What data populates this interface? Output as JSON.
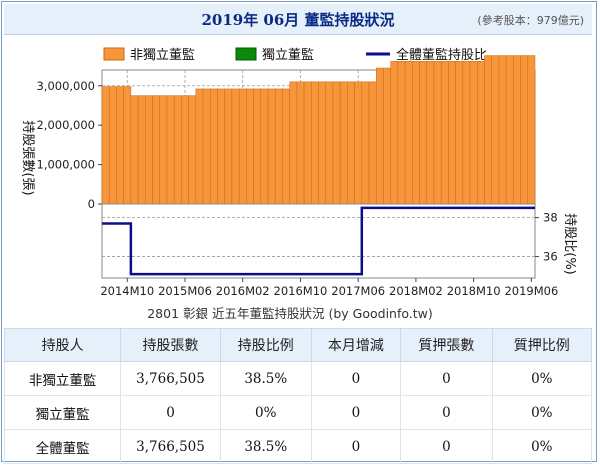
{
  "header": {
    "title": "2019年 06月 董監持股狀況",
    "note": "(參考股本：979億元)"
  },
  "colors": {
    "bar_fill": "#f7953a",
    "bar_stroke": "#c96a1c",
    "independent_fill": "#0a8a0a",
    "line": "#0d0d8a",
    "header_bg": "#e6f0fa"
  },
  "chart_data": {
    "type": "bar",
    "source_label": "2801 彰銀 近五年董監持股狀況 (by Goodinfo.tw)",
    "legend": [
      "非獨立董監",
      "獨立董監",
      "全體董監持股比"
    ],
    "ylabel_left": "持股張數(張)",
    "ylabel_right": "持股比(%)",
    "left_axis": {
      "ticks": [
        "3,000,000",
        "2,000,000",
        "1,000,000",
        "0"
      ],
      "tick_values": [
        3000000,
        2000000,
        1000000,
        0
      ],
      "ylim": [
        0,
        3400000
      ]
    },
    "right_axis": {
      "ticks": [
        "38",
        "36"
      ],
      "tick_values": [
        38,
        36
      ],
      "ylim": [
        34.9,
        38.7
      ]
    },
    "x_tick_labels": [
      "2014M10",
      "2015M06",
      "2016M02",
      "2016M10",
      "2017M06",
      "2018M02",
      "2018M10",
      "2019M06"
    ],
    "months": [
      "2014M07",
      "2014M08",
      "2014M09",
      "2014M10",
      "2014M11",
      "2014M12",
      "2015M01",
      "2015M02",
      "2015M03",
      "2015M04",
      "2015M05",
      "2015M06",
      "2015M07",
      "2015M08",
      "2015M09",
      "2015M10",
      "2015M11",
      "2015M12",
      "2016M01",
      "2016M02",
      "2016M03",
      "2016M04",
      "2016M05",
      "2016M06",
      "2016M07",
      "2016M08",
      "2016M09",
      "2016M10",
      "2016M11",
      "2016M12",
      "2017M01",
      "2017M02",
      "2017M03",
      "2017M04",
      "2017M05",
      "2017M06",
      "2017M07",
      "2017M08",
      "2017M09",
      "2017M10",
      "2017M11",
      "2017M12",
      "2018M01",
      "2018M02",
      "2018M03",
      "2018M04",
      "2018M05",
      "2018M06",
      "2018M07",
      "2018M08",
      "2018M09",
      "2018M10",
      "2018M11",
      "2018M12",
      "2019M01",
      "2019M02",
      "2019M03",
      "2019M04",
      "2019M05",
      "2019M06"
    ],
    "series": [
      {
        "name": "非獨立董監",
        "values": [
          2980000,
          2980000,
          2980000,
          2980000,
          2750000,
          2750000,
          2750000,
          2750000,
          2750000,
          2750000,
          2750000,
          2750000,
          2750000,
          2920000,
          2920000,
          2920000,
          2920000,
          2920000,
          2920000,
          2920000,
          2920000,
          2920000,
          2920000,
          2920000,
          2920000,
          2920000,
          3100000,
          3100000,
          3100000,
          3100000,
          3100000,
          3100000,
          3100000,
          3100000,
          3100000,
          3100000,
          3100000,
          3100000,
          3450000,
          3450000,
          3620000,
          3620000,
          3620000,
          3620000,
          3620000,
          3620000,
          3620000,
          3620000,
          3620000,
          3620000,
          3620000,
          3620000,
          3620000,
          3766505,
          3766505,
          3766505,
          3766505,
          3766505,
          3766505,
          3766505
        ]
      },
      {
        "name": "獨立董監",
        "values": [
          0,
          0,
          0,
          0,
          0,
          0,
          0,
          0,
          0,
          0,
          0,
          0,
          0,
          0,
          0,
          0,
          0,
          0,
          0,
          0,
          0,
          0,
          0,
          0,
          0,
          0,
          0,
          0,
          0,
          0,
          0,
          0,
          0,
          0,
          0,
          0,
          0,
          0,
          0,
          0,
          0,
          0,
          0,
          0,
          0,
          0,
          0,
          0,
          0,
          0,
          0,
          0,
          0,
          0,
          0,
          0,
          0,
          0,
          0,
          0
        ]
      },
      {
        "name": "全體董監持股比",
        "values": [
          37.7,
          37.7,
          37.7,
          37.7,
          35.1,
          35.1,
          35.1,
          35.1,
          35.1,
          35.1,
          35.1,
          35.1,
          35.1,
          35.1,
          35.1,
          35.1,
          35.1,
          35.1,
          35.1,
          35.1,
          35.1,
          35.1,
          35.1,
          35.1,
          35.1,
          35.1,
          35.1,
          35.1,
          35.1,
          35.1,
          35.1,
          35.1,
          35.1,
          35.1,
          35.1,
          35.1,
          38.5,
          38.5,
          38.5,
          38.5,
          38.5,
          38.5,
          38.5,
          38.5,
          38.5,
          38.5,
          38.5,
          38.5,
          38.5,
          38.5,
          38.5,
          38.5,
          38.5,
          38.5,
          38.5,
          38.5,
          38.5,
          38.5,
          38.5,
          38.5
        ]
      }
    ]
  },
  "table": {
    "headers": [
      "持股人",
      "持股張數",
      "持股比例",
      "本月增減",
      "質押張數",
      "質押比例"
    ],
    "rows": [
      [
        "非獨立董監",
        "3,766,505",
        "38.5%",
        "0",
        "0",
        "0%"
      ],
      [
        "獨立董監",
        "0",
        "0%",
        "0",
        "0",
        "0%"
      ],
      [
        "全體董監",
        "3,766,505",
        "38.5%",
        "0",
        "0",
        "0%"
      ]
    ]
  }
}
